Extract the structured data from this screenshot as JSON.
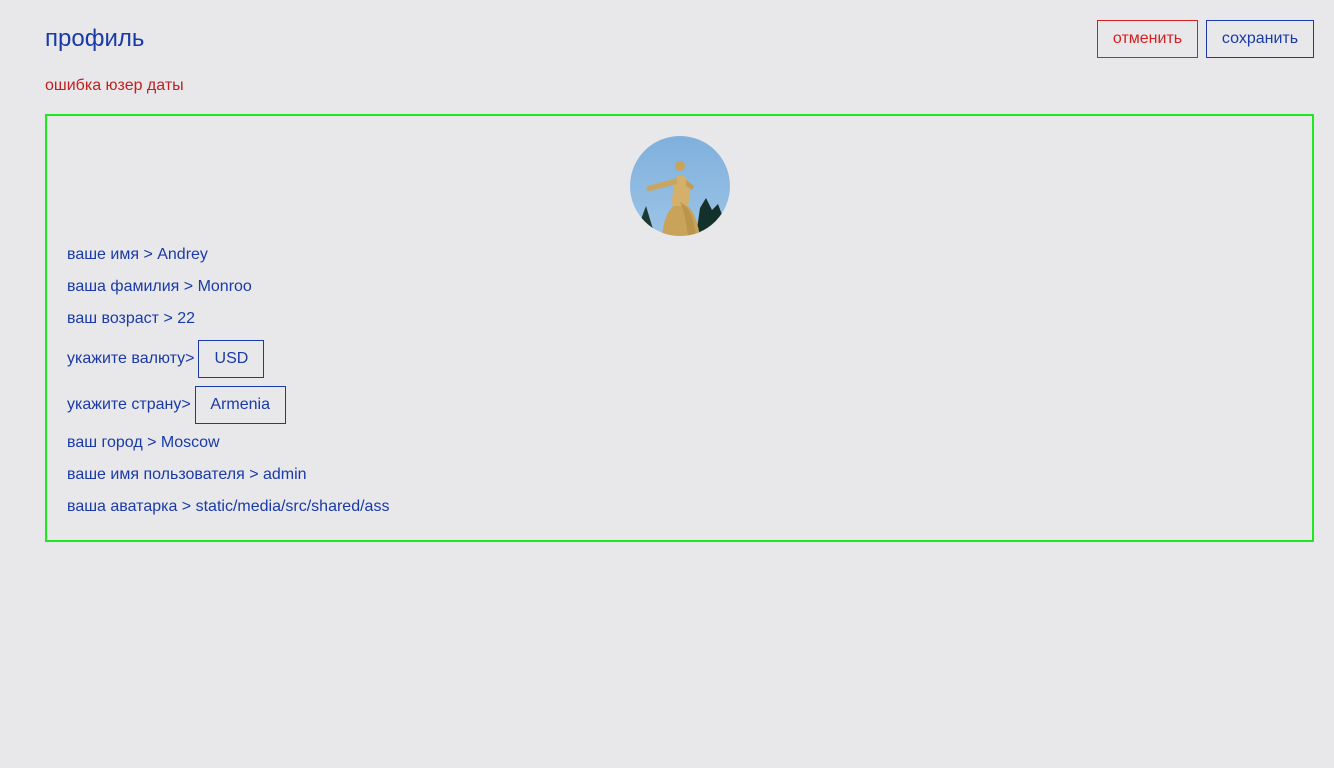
{
  "header": {
    "title": "профиль",
    "cancel_label": "отменить",
    "save_label": "сохранить"
  },
  "error_text": "ошибка юзер даты",
  "colors": {
    "background": "#e8e8eb",
    "primary": "#1a3aa6",
    "danger": "#d42020",
    "card_border": "#1ee81e"
  },
  "profile": {
    "first_name": "ваше имя > Andrey",
    "last_name": "ваша фамилия > Monroo",
    "age": "ваш возраст > 22",
    "currency_label": "укажите валюту>",
    "currency_value": "USD",
    "country_label": "укажите страну>",
    "country_value": "Armenia",
    "city": "ваш город > Moscow",
    "username": "ваше имя пользователя > admin",
    "avatar_path": "ваша аватарка > static/media/src/shared/ass"
  }
}
